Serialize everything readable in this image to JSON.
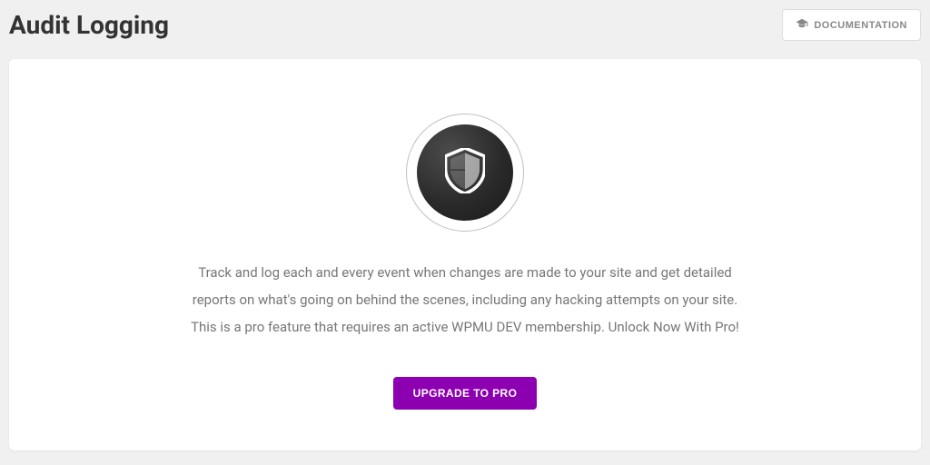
{
  "header": {
    "title": "Audit Logging",
    "doc_button_label": "DOCUMENTATION"
  },
  "main": {
    "icon_name": "shield-icon",
    "description": "Track and log each and every event when changes are made to your site and get detailed reports on what's going on behind the scenes, including any hacking attempts on your site. This is a pro feature that requires an active WPMU DEV membership. Unlock Now With Pro!",
    "upgrade_button_label": "UPGRADE TO PRO"
  },
  "colors": {
    "accent": "#8d00b1",
    "text_muted": "#777",
    "page_bg": "#f0f0f0"
  }
}
